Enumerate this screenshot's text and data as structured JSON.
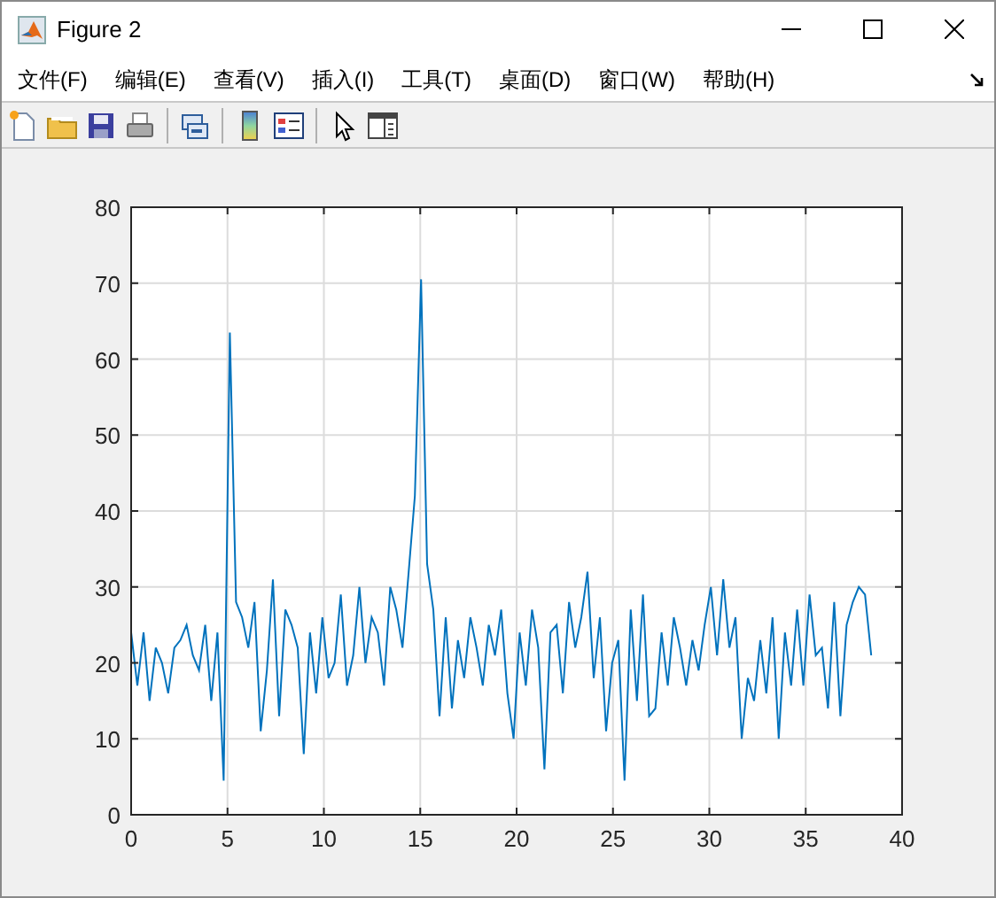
{
  "window": {
    "title": "Figure 2"
  },
  "menu": [
    "文件(F)",
    "编辑(E)",
    "查看(V)",
    "插入(I)",
    "工具(T)",
    "桌面(D)",
    "窗口(W)",
    "帮助(H)"
  ],
  "toolbar": [
    {
      "kind": "new"
    },
    {
      "kind": "open"
    },
    {
      "kind": "save"
    },
    {
      "kind": "print"
    },
    {
      "kind": "separator"
    },
    {
      "kind": "link"
    },
    {
      "kind": "separator"
    },
    {
      "kind": "colorbar"
    },
    {
      "kind": "legend"
    },
    {
      "kind": "separator"
    },
    {
      "kind": "pointer"
    },
    {
      "kind": "panel"
    }
  ],
  "chart_data": {
    "type": "line",
    "grid": true,
    "xlim": [
      0,
      40
    ],
    "ylim": [
      0,
      80
    ],
    "xticks": [
      0,
      5,
      10,
      15,
      20,
      25,
      30,
      35,
      40
    ],
    "yticks": [
      0,
      10,
      20,
      30,
      40,
      50,
      60,
      70,
      80
    ],
    "x": [
      0,
      0.32,
      0.64,
      0.96,
      1.28,
      1.6,
      1.92,
      2.24,
      2.56,
      2.88,
      3.2,
      3.52,
      3.84,
      4.16,
      4.48,
      4.8,
      5.12,
      5.44,
      5.76,
      6.08,
      6.4,
      6.72,
      7.04,
      7.36,
      7.68,
      8,
      8.32,
      8.64,
      8.96,
      9.28,
      9.6,
      9.92,
      10.24,
      10.56,
      10.88,
      11.2,
      11.52,
      11.84,
      12.16,
      12.48,
      12.8,
      13.12,
      13.44,
      13.76,
      14.08,
      14.4,
      14.72,
      15.04,
      15.36,
      15.68,
      16,
      16.32,
      16.64,
      16.96,
      17.28,
      17.6,
      17.92,
      18.24,
      18.56,
      18.88,
      19.2,
      19.52,
      19.84,
      20.16,
      20.48,
      20.8,
      21.12,
      21.44,
      21.76,
      22.08,
      22.4,
      22.72,
      23.04,
      23.36,
      23.68,
      24,
      24.32,
      24.64,
      24.96,
      25.28,
      25.6,
      25.92,
      26.24,
      26.56,
      26.88,
      27.2,
      27.52,
      27.84,
      28.16,
      28.48,
      28.8,
      29.12,
      29.44,
      29.76,
      30.08,
      30.4,
      30.72,
      31.04,
      31.36,
      31.68,
      32,
      32.32,
      32.64,
      32.96,
      33.28,
      33.6,
      33.92,
      34.24,
      34.56,
      34.88,
      35.2,
      35.52,
      35.84,
      36.16,
      36.48,
      36.8,
      37.12,
      37.44,
      37.76,
      38.08,
      38.4
    ],
    "series": [
      {
        "color": "#0072bd",
        "values": [
          24,
          17,
          24,
          15,
          22,
          20,
          16,
          22,
          23,
          25,
          21,
          19,
          25,
          15,
          24,
          4.5,
          63.5,
          28,
          26,
          22,
          28,
          11,
          19,
          31,
          13,
          27,
          25,
          22,
          8,
          24,
          16,
          26,
          18,
          20,
          29,
          17,
          21,
          30,
          20,
          26,
          24,
          17,
          30,
          27,
          22,
          32,
          42,
          70.5,
          33,
          27,
          13,
          26,
          14,
          23,
          18,
          26,
          22,
          17,
          25,
          21,
          27,
          16,
          10,
          24,
          17,
          27,
          22,
          6,
          24,
          25,
          16,
          28,
          22,
          26,
          32,
          18,
          26,
          11,
          20,
          23,
          4.5,
          27,
          15,
          29,
          13,
          14,
          24,
          17,
          26,
          22,
          17,
          23,
          19,
          25,
          30,
          21,
          31,
          22,
          26,
          10,
          18,
          15,
          23,
          16,
          26,
          10,
          24,
          17,
          27,
          17,
          29,
          21,
          22,
          14,
          28,
          13,
          25,
          28,
          30,
          29,
          21
        ]
      }
    ]
  }
}
